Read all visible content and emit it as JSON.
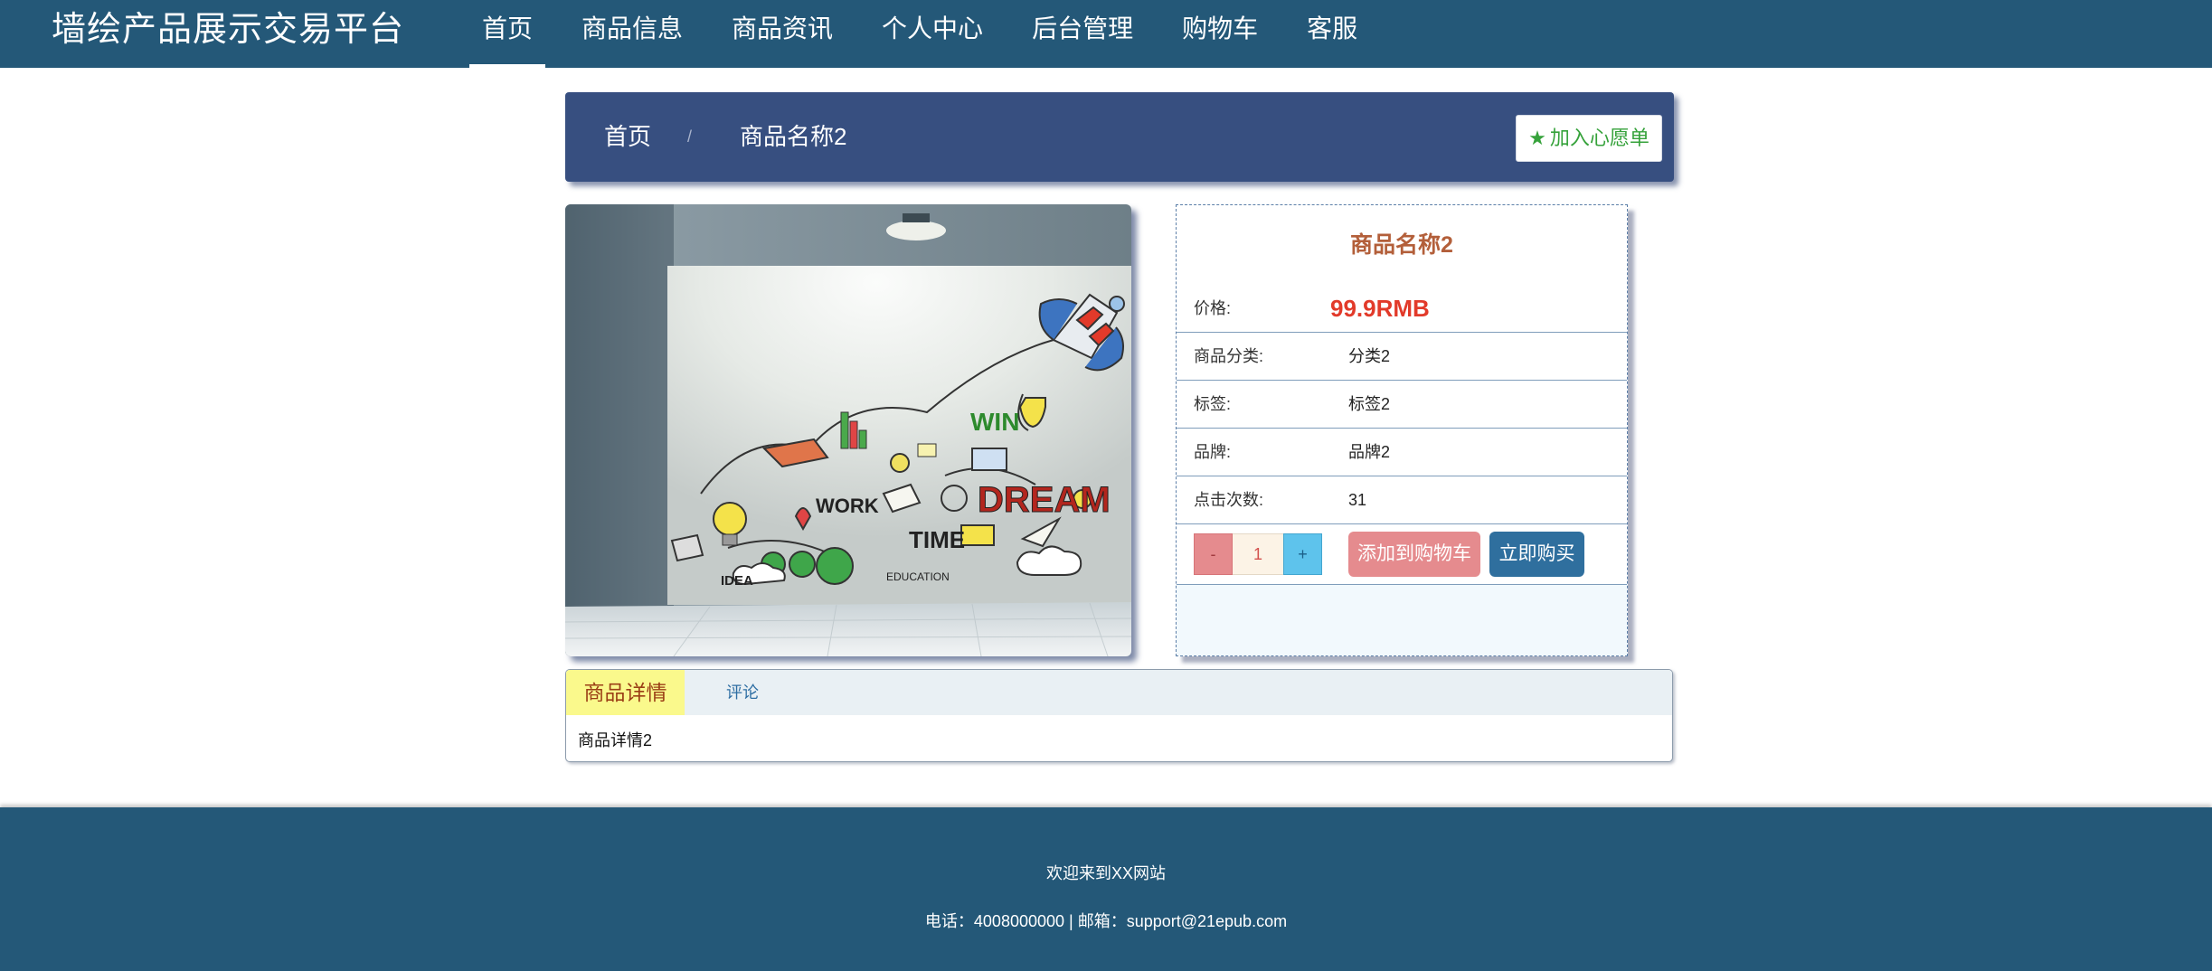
{
  "header": {
    "brand": "墙绘产品展示交易平台",
    "nav": [
      {
        "label": "首页"
      },
      {
        "label": "商品信息"
      },
      {
        "label": "商品资讯"
      },
      {
        "label": "个人中心"
      },
      {
        "label": "后台管理"
      },
      {
        "label": "购物车"
      },
      {
        "label": "客服"
      }
    ]
  },
  "breadcrumb": {
    "home": "首页",
    "separator": "/",
    "current": "商品名称2",
    "wishlist_label": "加入心愿单",
    "wishlist_icon": "star-icon"
  },
  "product": {
    "image_text": {
      "win": "WIN",
      "work": "WORK",
      "dream": "DREAM",
      "time": "TIME",
      "idea": "IDEA",
      "education": "EDUCATION"
    },
    "name": "商品名称2",
    "price_label": "价格:",
    "price": "99.9RMB",
    "category_label": "商品分类:",
    "category": "分类2",
    "tag_label": "标签:",
    "tag": "标签2",
    "brand_label": "品牌:",
    "brand": "品牌2",
    "clicks_label": "点击次数:",
    "clicks": "31",
    "quantity": {
      "minus": "-",
      "value": "1",
      "plus": "+"
    },
    "add_to_cart": "添加到购物车",
    "buy_now": "立即购买"
  },
  "tabs": {
    "detail_label": "商品详情",
    "comment_label": "评论",
    "detail_content": "商品详情2"
  },
  "footer": {
    "welcome": "欢迎来到XX网站",
    "contact": "电话：4008000000 | 邮箱：support@21epub.com"
  },
  "colors": {
    "nav_bg": "#245878",
    "crumb_bg": "#374f80",
    "price_red": "#e23a2a",
    "title_brown": "#b35f3a",
    "wish_green": "#36a23b",
    "cart_pink": "#e58b8e",
    "buy_blue": "#2f6f9e"
  }
}
